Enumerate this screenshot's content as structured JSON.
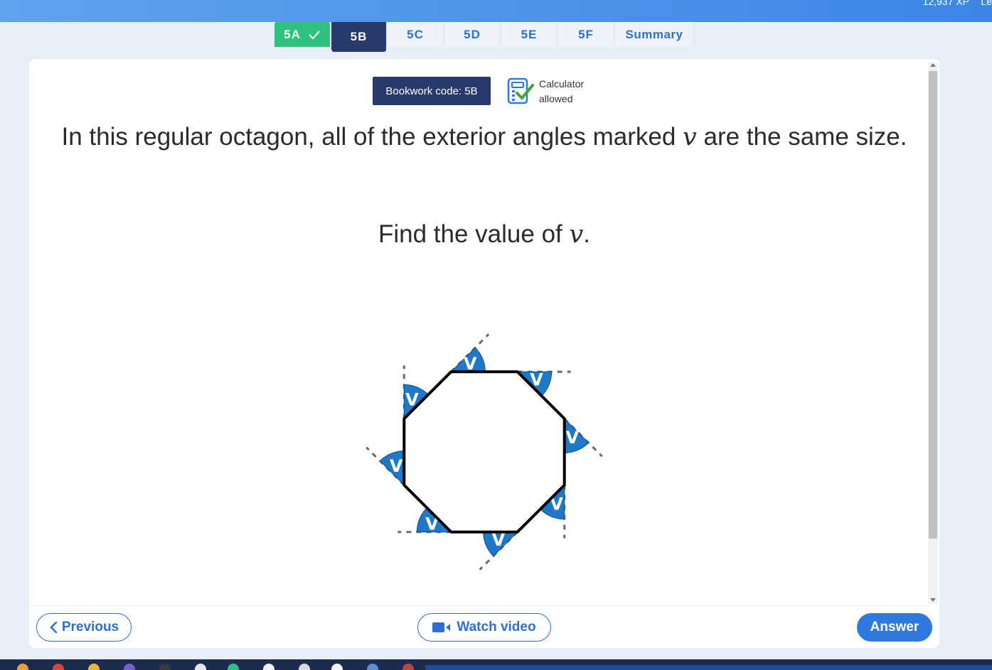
{
  "header": {
    "xp": "12,937 XP",
    "extra": "Le"
  },
  "tabs": [
    {
      "label": "5A",
      "state": "done"
    },
    {
      "label": "5B",
      "state": "active"
    },
    {
      "label": "5C",
      "state": "normal"
    },
    {
      "label": "5D",
      "state": "normal"
    },
    {
      "label": "5E",
      "state": "normal"
    },
    {
      "label": "5F",
      "state": "normal"
    },
    {
      "label": "Summary",
      "state": "normal"
    }
  ],
  "bookwork": {
    "label": "Bookwork code: 5B"
  },
  "calculator": {
    "line1": "Calculator",
    "line2": "allowed",
    "icon": "calculator-check-icon"
  },
  "question": {
    "text_before": "In this regular octagon, all of the exterior angles marked ",
    "variable": "v",
    "text_after": " are the same size.",
    "find_before": "Find the value of ",
    "find_after": "."
  },
  "diagram": {
    "shape": "regular octagon",
    "angle_label": "V",
    "angle_count": 8,
    "colors": {
      "sector": "#1f78c8",
      "outline": "#000000",
      "dash": "#6b6b6b"
    }
  },
  "footer": {
    "previous_label": "Previous",
    "video_label": "Watch video",
    "answer_label": "Answer"
  },
  "colors": {
    "accent": "#2e6fd4",
    "navy": "#273a6b",
    "done": "#2ec27e"
  }
}
